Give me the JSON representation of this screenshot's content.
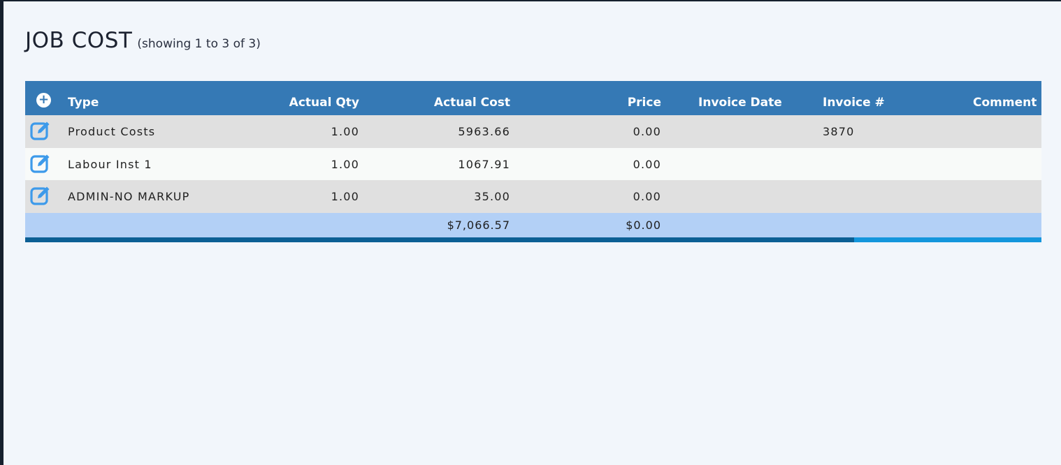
{
  "page": {
    "title": "JOB COST",
    "subtitle": "(showing 1 to 3 of 3)"
  },
  "table": {
    "columns": [
      "Type",
      "Actual Qty",
      "Actual Cost",
      "Price",
      "Invoice Date",
      "Invoice #",
      "Comment"
    ],
    "rows": [
      {
        "type": "Product Costs",
        "qty": "1.00",
        "cost": "5963.66",
        "price": "0.00",
        "invoice_date": "",
        "invoice_no": "3870",
        "comment": ""
      },
      {
        "type": "Labour Inst 1",
        "qty": "1.00",
        "cost": "1067.91",
        "price": "0.00",
        "invoice_date": "",
        "invoice_no": "",
        "comment": ""
      },
      {
        "type": "ADMIN-NO MARKUP",
        "qty": "1.00",
        "cost": "35.00",
        "price": "0.00",
        "invoice_date": "",
        "invoice_no": "",
        "comment": ""
      }
    ],
    "totals": {
      "cost": "$7,066.57",
      "price": "$0.00"
    }
  },
  "icons": {
    "add": "plus-circle-icon",
    "edit": "edit-square-icon"
  },
  "colors": {
    "header_bg": "#3579b5",
    "row_alt_bg": "#e0e0e0",
    "total_bg": "#b3d0f6",
    "edit_icon": "#3d9aea"
  }
}
